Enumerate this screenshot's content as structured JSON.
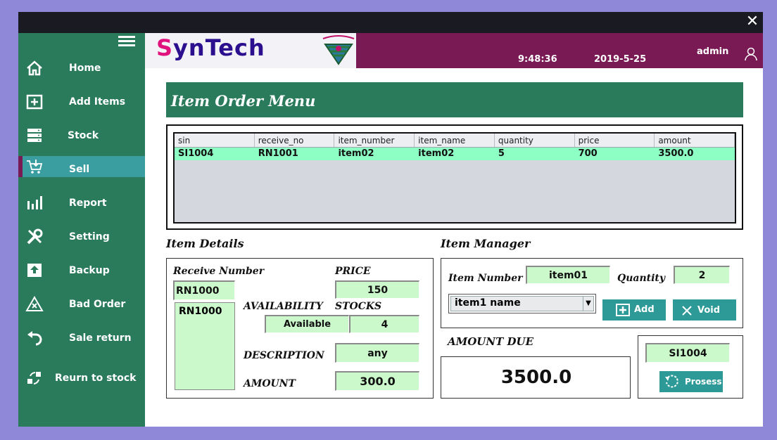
{
  "window": {
    "close_glyph": "✕"
  },
  "sidebar": {
    "items": [
      {
        "label": "Home",
        "icon": "home-icon"
      },
      {
        "label": "Add Items",
        "icon": "add-box-icon"
      },
      {
        "label": "Stock",
        "icon": "database-icon"
      },
      {
        "label": "Sell",
        "icon": "cart-icon",
        "active": true
      },
      {
        "label": "Report",
        "icon": "bar-chart-icon"
      },
      {
        "label": "Setting",
        "icon": "tools-icon"
      },
      {
        "label": "Backup",
        "icon": "upload-icon"
      },
      {
        "label": "Bad Order",
        "icon": "warning-icon"
      },
      {
        "label": "Sale return",
        "icon": "undo-icon"
      },
      {
        "label": "Reurn to stock",
        "icon": "transfer-icon"
      }
    ]
  },
  "header": {
    "brand_first": "S",
    "brand_rest": "ynTech",
    "time": "9:48:36",
    "date": "2019-5-25",
    "user": "admin"
  },
  "main": {
    "title": "Item Order Menu"
  },
  "order_table": {
    "columns": [
      "sin",
      "receive_no",
      "item_number",
      "item_name",
      "quantity",
      "price",
      "amount"
    ],
    "rows": [
      [
        "SI1004",
        "RN1001",
        "item02",
        "item02",
        "5",
        "700",
        "3500.0"
      ]
    ]
  },
  "item_details": {
    "title": "Item Details",
    "receive_number_label": "Receive Number",
    "receive_number_value": "RN1000",
    "receive_list": [
      "RN1000"
    ],
    "price_label": "PRICE",
    "price_value": "150",
    "availability_label": "AVAILABILITY",
    "availability_value": "Available",
    "stocks_label": "STOCKS",
    "stocks_value": "4",
    "description_label": "DESCRIPTION",
    "description_value": "any",
    "amount_label": "AMOUNT",
    "amount_value": "300.0"
  },
  "item_manager": {
    "title": "Item Manager",
    "item_number_label": "Item Number",
    "item_number_value": "item01",
    "quantity_label": "Quantity",
    "quantity_value": "2",
    "item_select_value": "item1 name",
    "add_label": "Add",
    "void_label": "Void"
  },
  "amount_due": {
    "title": "AMOUNT DUE",
    "value": "3500.0"
  },
  "process": {
    "sin_value": "SI1004",
    "button_label": "Prosess"
  },
  "colors": {
    "sidebar": "#2a7a5c",
    "header": "#7a1a55",
    "active_nav": "#3a9ea0",
    "field": "#ccf9cc",
    "button": "#2d9a97",
    "selected_row": "#8effc4"
  }
}
